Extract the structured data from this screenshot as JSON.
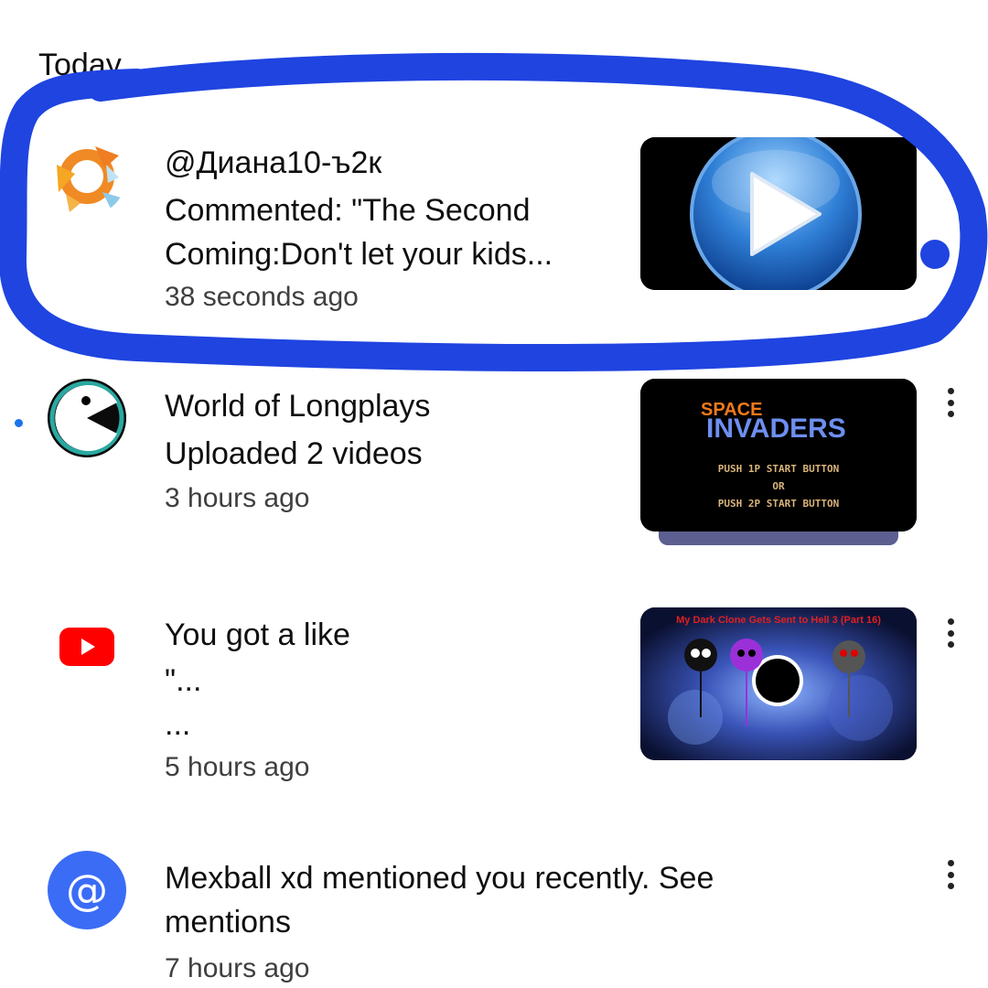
{
  "section": {
    "title": "Today"
  },
  "notifications": [
    {
      "channel": "@Диана10-ъ2к",
      "line1": "Commented: \"The Second",
      "line2": "Coming:Don't let your kids...",
      "time": "38 seconds ago",
      "avatar_icon": "orange-abstract-avatar",
      "thumbnail_icon": "play-button-icon"
    },
    {
      "line1": "World of Longplays",
      "line2": "Uploaded 2 videos",
      "time": "3 hours ago",
      "unread": true,
      "avatar_icon": "pacman-logo-avatar",
      "thumbnail": {
        "word1": "SPACE",
        "word2": "INVADERS",
        "line1": "PUSH  1P  START  BUTTON",
        "line2": "OR",
        "line3": "PUSH  2P  START  BUTTON"
      }
    },
    {
      "line1": "You got a like",
      "line2": "\"...",
      "line3": "...",
      "time": "5 hours ago",
      "avatar_icon": "youtube-logo-icon",
      "thumbnail": {
        "title": "My Dark Clone Gets Sent to Hell 3 (Part 16)"
      }
    },
    {
      "line1": "Mexball xd mentioned you recently. See",
      "line2": "mentions",
      "time": "7 hours ago",
      "avatar_icon": "at-sign-icon"
    }
  ],
  "colors": {
    "scribble": "#1f44e0",
    "unread_dot": "#1a73e8",
    "youtube_red": "#ff0000",
    "mention_blue": "#3b6cf6"
  }
}
